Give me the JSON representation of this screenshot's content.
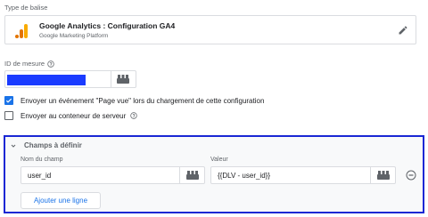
{
  "tag_type": {
    "section_label": "Type de balise",
    "title": "Google Analytics : Configuration GA4",
    "subtitle": "Google Marketing Platform",
    "icon": "google-analytics-icon",
    "brand_color": "#F9AB00"
  },
  "measurement": {
    "label": "ID de mesure",
    "help_icon": "help-icon",
    "value_redacted": true,
    "redaction_color": "#1A3BFF",
    "variable_icon": "variable-picker-icon"
  },
  "options": [
    {
      "label": "Envoyer un événement \"Page vue\" lors du chargement de cette configuration",
      "checked": true
    },
    {
      "label": "Envoyer au conteneur de serveur",
      "checked": false,
      "help_icon": "help-icon"
    }
  ],
  "fields": {
    "title": "Champs à définir",
    "expanded": true,
    "field_name_label": "Nom du champ",
    "value_label": "Valeur",
    "rows": [
      {
        "name": "user_id",
        "value": "{{DLV - user_id}}"
      }
    ],
    "add_row_label": "Ajouter une ligne",
    "highlight_color": "#1A27D4"
  },
  "colors": {
    "accent": "#1A73E8",
    "border": "#DADCE0",
    "muted_text": "#5F6368"
  }
}
